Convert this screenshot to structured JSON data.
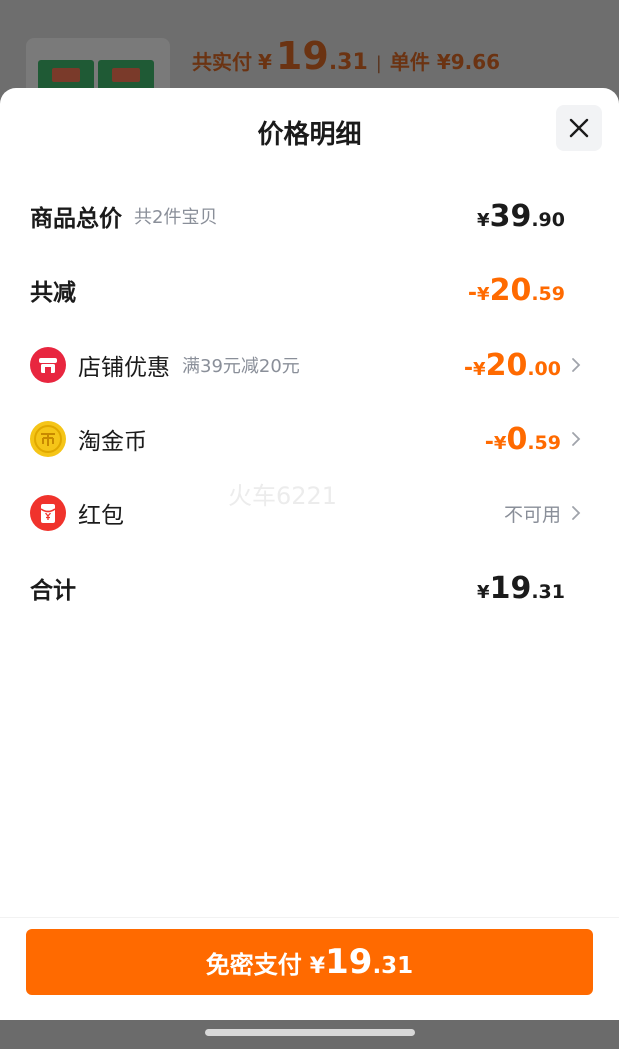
{
  "background_product": {
    "total_label": "共实付",
    "yen": "¥",
    "total_int": "19",
    "total_dec": ".31",
    "separator": "|",
    "unit_label": "单件 ¥9.66"
  },
  "sheet": {
    "title": "价格明细",
    "close_icon": "close-icon"
  },
  "rows": {
    "goods_total": {
      "label": "商品总价",
      "sub": "共2件宝贝",
      "yen": "¥",
      "int": "39",
      "dec": ".90"
    },
    "total_discount": {
      "label": "共减",
      "sign": "-",
      "yen": "¥",
      "int": "20",
      "dec": ".59"
    },
    "store_coupon": {
      "label": "店铺优惠",
      "sub": "满39元减20元",
      "sign": "-",
      "yen": "¥",
      "int": "20",
      "dec": ".00",
      "icon": "store-icon"
    },
    "tao_coin": {
      "label": "淘金币",
      "sign": "-",
      "yen": "¥",
      "int": "0",
      "dec": ".59",
      "icon": "coin-icon"
    },
    "red_packet": {
      "label": "红包",
      "status": "不可用",
      "icon": "red-packet-icon"
    },
    "sum": {
      "label": "合计",
      "yen": "¥",
      "int": "19",
      "dec": ".31"
    }
  },
  "watermark": "火车6221",
  "pay_button": {
    "label": "免密支付",
    "yen": "¥",
    "int": "19",
    "dec": ".31"
  },
  "colors": {
    "accent": "#ff6a00",
    "text": "#1b1b1b",
    "muted": "#8a8f99",
    "store_icon": "#e8263f",
    "coin_icon": "#f5c518",
    "red_packet_icon": "#f0332c"
  }
}
